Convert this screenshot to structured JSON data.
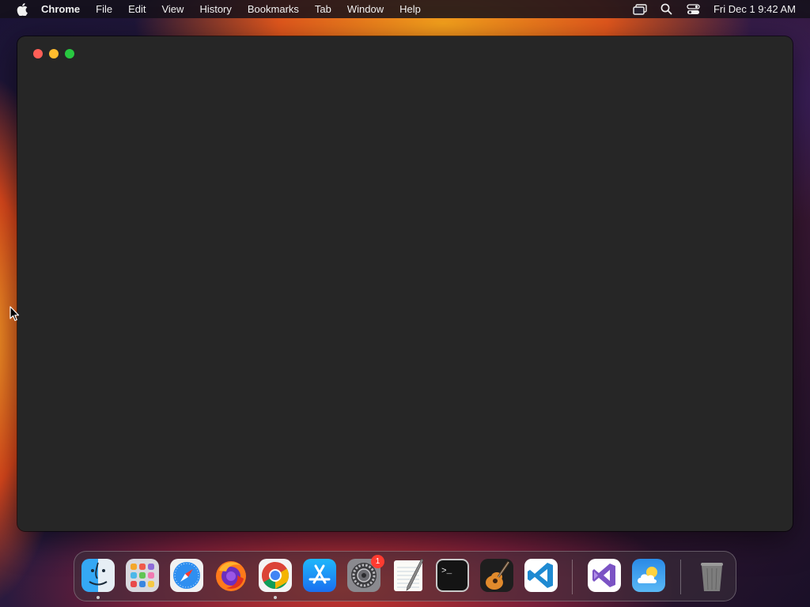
{
  "menubar": {
    "app_name": "Chrome",
    "menus": [
      "File",
      "Edit",
      "View",
      "History",
      "Bookmarks",
      "Tab",
      "Window",
      "Help"
    ],
    "clock": "Fri Dec 1  9:42 AM",
    "status_icons": [
      "screen-mirroring-icon",
      "spotlight-search-icon",
      "control-center-icon"
    ]
  },
  "window": {
    "traffic_lights": [
      "close",
      "minimize",
      "zoom"
    ],
    "colors": {
      "close": "#ff5f57",
      "minimize": "#febc2e",
      "zoom": "#28c840",
      "background": "#262626"
    }
  },
  "dock": {
    "items": [
      {
        "name": "Finder",
        "icon": "finder-icon",
        "running": true
      },
      {
        "name": "Launchpad",
        "icon": "launchpad-icon",
        "running": false
      },
      {
        "name": "Safari",
        "icon": "safari-icon",
        "running": false
      },
      {
        "name": "Firefox",
        "icon": "firefox-icon",
        "running": false
      },
      {
        "name": "Chrome",
        "icon": "chrome-icon",
        "running": true
      },
      {
        "name": "App Store",
        "icon": "app-store-icon",
        "running": false
      },
      {
        "name": "System Settings",
        "icon": "system-settings-icon",
        "running": false,
        "badge": "1"
      },
      {
        "name": "TextEdit",
        "icon": "textedit-icon",
        "running": false
      },
      {
        "name": "Terminal",
        "icon": "terminal-icon",
        "running": false
      },
      {
        "name": "GarageBand",
        "icon": "garageband-icon",
        "running": false
      },
      {
        "name": "Visual Studio Code",
        "icon": "vscode-icon",
        "running": false
      },
      {
        "name": "Visual Studio",
        "icon": "visual-studio-icon",
        "running": false
      },
      {
        "name": "Weather",
        "icon": "weather-icon",
        "running": false
      },
      {
        "name": "Trash",
        "icon": "trash-icon",
        "running": false
      }
    ],
    "terminal_prompt": ">_"
  }
}
